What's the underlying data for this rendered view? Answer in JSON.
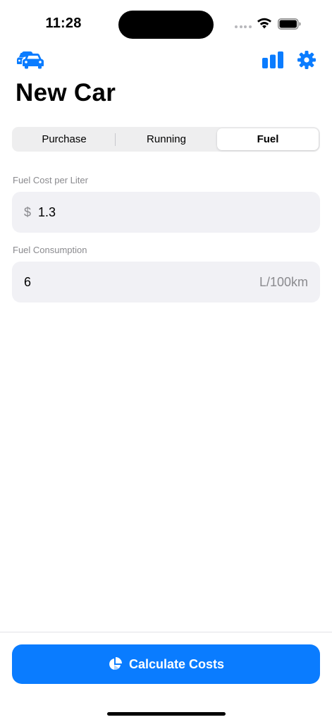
{
  "status_bar": {
    "time": "11:28"
  },
  "nav": {
    "cars_icon": "cars-icon",
    "stats_icon": "bar-chart-icon",
    "settings_icon": "gear-icon"
  },
  "title": "New Car",
  "tabs": [
    {
      "label": "Purchase",
      "selected": false
    },
    {
      "label": "Running",
      "selected": false
    },
    {
      "label": "Fuel",
      "selected": true
    }
  ],
  "fields": {
    "fuel_cost": {
      "label": "Fuel Cost per Liter",
      "prefix": "$",
      "value": "1.3"
    },
    "fuel_consumption": {
      "label": "Fuel Consumption",
      "value": "6",
      "unit": "L/100km"
    }
  },
  "action": {
    "label": "Calculate Costs",
    "icon": "pie-chart-icon"
  },
  "colors": {
    "accent": "#0a7cff",
    "field_bg": "#f1f1f5",
    "secondary_text": "#8a8a8e"
  }
}
